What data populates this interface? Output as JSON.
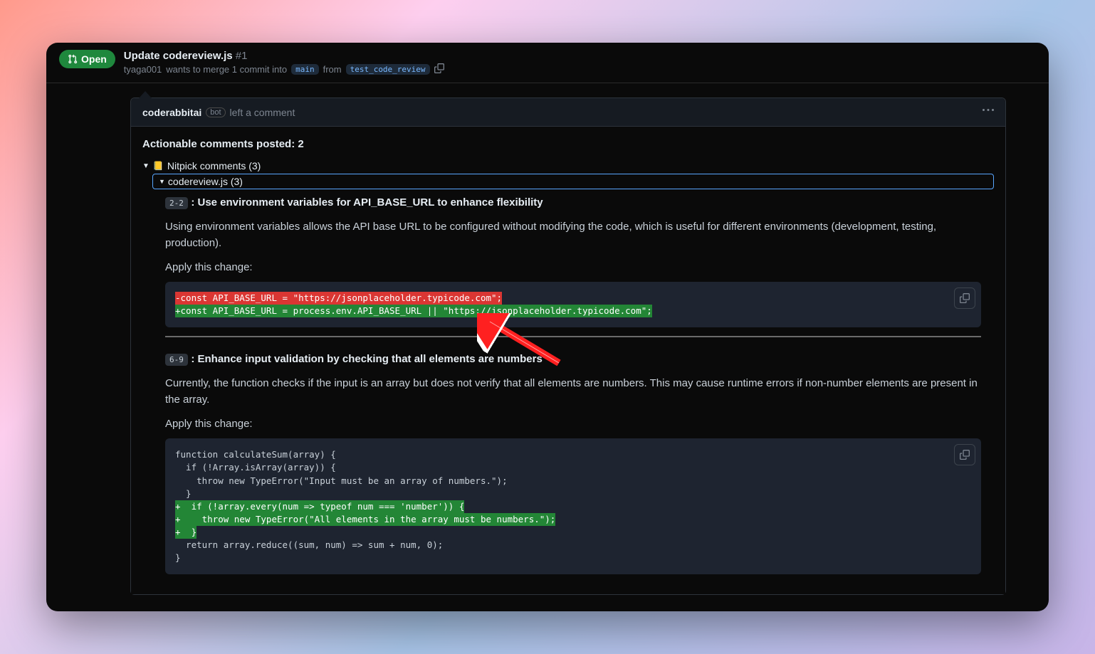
{
  "header": {
    "status": "Open",
    "title": "Update codereview.js",
    "pr_number": "#1",
    "author": "tyaga001",
    "merge_text_1": "wants to merge 1 commit into",
    "base_branch": "main",
    "from_text": "from",
    "compare_branch": "test_code_review"
  },
  "comment": {
    "author": "coderabbitai",
    "bot_label": "bot",
    "action_text": "left a comment",
    "actionable_title": "Actionable comments posted: 2",
    "nitpick_label": "Nitpick comments (3)",
    "file_label": "codereview.js (3)",
    "items": [
      {
        "line_range": "2-2",
        "title": ": Use environment variables for API_BASE_URL to enhance flexibility",
        "description": "Using environment variables allows the API base URL to be configured without modifying the code, which is useful for different environments (development, testing, production).",
        "apply_label": "Apply this change:",
        "code": {
          "lines": [
            {
              "type": "del",
              "text": "-const API_BASE_URL = \"https://jsonplaceholder.typicode.com\";"
            },
            {
              "type": "add",
              "text": "+const API_BASE_URL = process.env.API_BASE_URL || \"https://jsonplaceholder.typicode.com\";"
            }
          ]
        }
      },
      {
        "line_range": "6-9",
        "title": ": Enhance input validation by checking that all elements are numbers",
        "description": "Currently, the function checks if the input is an array but does not verify that all elements are numbers. This may cause runtime errors if non-number elements are present in the array.",
        "apply_label": "Apply this change:",
        "code": {
          "lines": [
            {
              "type": "ctx",
              "text": "function calculateSum(array) {"
            },
            {
              "type": "ctx",
              "text": "  if (!Array.isArray(array)) {"
            },
            {
              "type": "ctx",
              "text": "    throw new TypeError(\"Input must be an array of numbers.\");"
            },
            {
              "type": "ctx",
              "text": "  }"
            },
            {
              "type": "add",
              "text": "+  if (!array.every(num => typeof num === 'number')) {"
            },
            {
              "type": "add",
              "text": "+    throw new TypeError(\"All elements in the array must be numbers.\");"
            },
            {
              "type": "add",
              "text": "+  }"
            },
            {
              "type": "ctx",
              "text": "  return array.reduce((sum, num) => sum + num, 0);"
            },
            {
              "type": "ctx",
              "text": "}"
            }
          ]
        }
      }
    ]
  }
}
